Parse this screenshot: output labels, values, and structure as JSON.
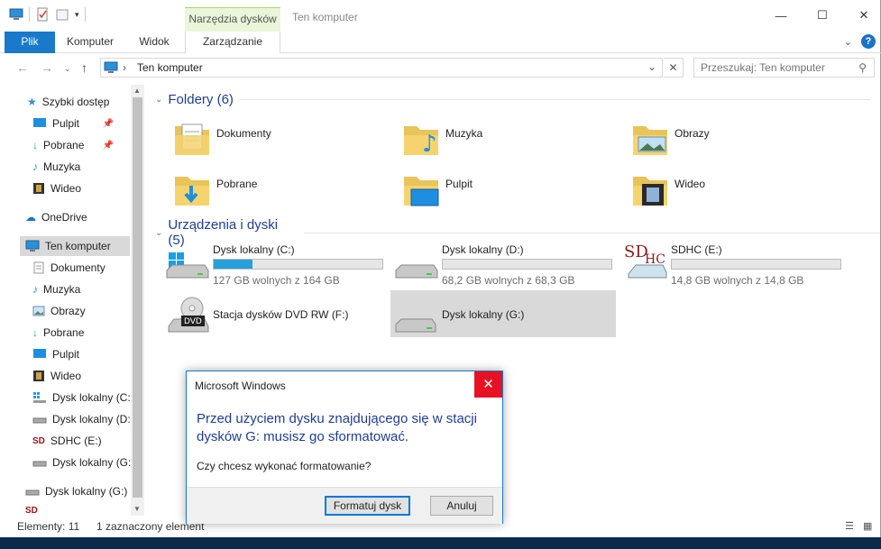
{
  "window": {
    "title": "Ten komputer",
    "context_tab_group": "Narzędzia dysków"
  },
  "ribbon": {
    "tabs": [
      {
        "label": "Plik"
      },
      {
        "label": "Komputer"
      },
      {
        "label": "Widok"
      },
      {
        "label": "Zarządzanie"
      }
    ]
  },
  "address": {
    "path": "Ten komputer",
    "search_placeholder": "Przeszukaj: Ten komputer"
  },
  "sidebar": {
    "items": [
      {
        "label": "Szybki dostęp",
        "icon": "star-icon"
      },
      {
        "label": "Pulpit",
        "icon": "desktop-icon",
        "pinned": true
      },
      {
        "label": "Pobrane",
        "icon": "download-icon",
        "pinned": true
      },
      {
        "label": "Muzyka",
        "icon": "music-icon"
      },
      {
        "label": "Wideo",
        "icon": "video-icon"
      },
      {
        "label": "OneDrive",
        "icon": "cloud-icon"
      },
      {
        "label": "Ten komputer",
        "icon": "computer-icon"
      },
      {
        "label": "Dokumenty",
        "icon": "documents-icon"
      },
      {
        "label": "Muzyka",
        "icon": "music-icon"
      },
      {
        "label": "Obrazy",
        "icon": "pictures-icon"
      },
      {
        "label": "Pobrane",
        "icon": "download-icon"
      },
      {
        "label": "Pulpit",
        "icon": "desktop-icon"
      },
      {
        "label": "Wideo",
        "icon": "video-icon"
      },
      {
        "label": "Dysk lokalny (C:)",
        "icon": "windows-drive-icon"
      },
      {
        "label": "Dysk lokalny (D:)",
        "icon": "drive-icon"
      },
      {
        "label": "SDHC (E:)",
        "icon": "sd-card-icon"
      },
      {
        "label": "Dysk lokalny (G:)",
        "icon": "drive-icon"
      },
      {
        "label": "Dysk lokalny (G:)",
        "icon": "drive-icon"
      },
      {
        "label": "SD",
        "icon": "sd-card-icon"
      }
    ]
  },
  "main": {
    "folders_header": "Foldery (6)",
    "folders": [
      {
        "label": "Dokumenty",
        "icon": "documents-folder-icon"
      },
      {
        "label": "Muzyka",
        "icon": "music-folder-icon"
      },
      {
        "label": "Obrazy",
        "icon": "pictures-folder-icon"
      },
      {
        "label": "Pobrane",
        "icon": "downloads-folder-icon"
      },
      {
        "label": "Pulpit",
        "icon": "desktop-folder-icon"
      },
      {
        "label": "Wideo",
        "icon": "video-folder-icon"
      }
    ],
    "devices_header": "Urządzenia i dyski (5)",
    "devices": [
      {
        "label": "Dysk lokalny (C:)",
        "free": "127 GB wolnych z 164 GB",
        "used_fraction": 0.23,
        "icon": "windows-drive-icon"
      },
      {
        "label": "Dysk lokalny (D:)",
        "free": "68,2 GB wolnych z 68,3 GB",
        "used_fraction": 0.0,
        "icon": "drive-icon"
      },
      {
        "label": "SDHC (E:)",
        "free": "14,8 GB wolnych z 14,8 GB",
        "used_fraction": 0.0,
        "icon": "sd-card-icon"
      },
      {
        "label": "Stacja dysków DVD RW (F:)",
        "icon": "dvd-drive-icon"
      },
      {
        "label": "Dysk lokalny (G:)",
        "icon": "drive-icon",
        "selected": true
      }
    ]
  },
  "status": {
    "count": "Elementy: 11",
    "selection": "1 zaznaczony element"
  },
  "dialog": {
    "title": "Microsoft Windows",
    "main_instruction": "Przed użyciem dysku znajdującego się w stacji dysków G: musisz go sformatować.",
    "content": "Czy chcesz wykonać formatowanie?",
    "primary_button": "Formatuj dysk",
    "secondary_button": "Anuluj"
  },
  "colors": {
    "accent": "#1979ca",
    "header_text": "#1e3f8f",
    "context_tab": "#e9f6d8",
    "close_red": "#e81123",
    "progress": "#26a0da"
  }
}
